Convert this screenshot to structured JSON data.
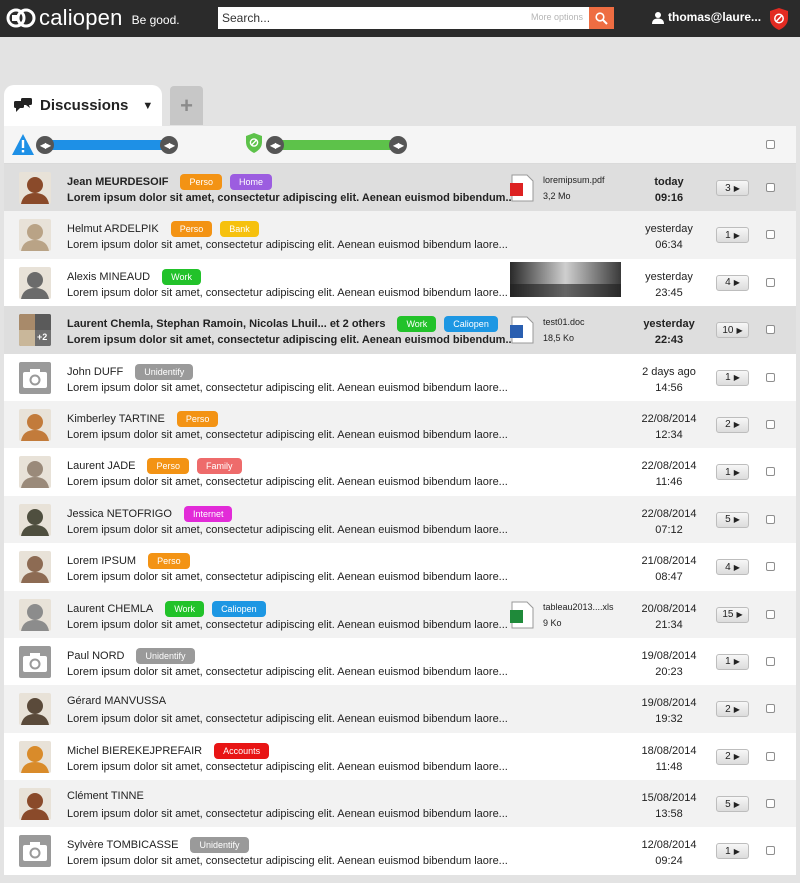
{
  "header": {
    "brand": "caliopen",
    "tagline": "Be good.",
    "search_placeholder": "Search...",
    "more_options": "More options",
    "user": "thomas@laure..."
  },
  "tabs": {
    "active_label": "Discussions",
    "add_label": "+"
  },
  "colors": {
    "topbar": "#2b2b2b",
    "accent": "#ee6d42",
    "privacy_blue": "#1e90e6",
    "importance_green": "#5dc24a",
    "tag_perso": "#f39314",
    "tag_home": "#9c5de0",
    "tag_bank": "#f6c10e",
    "tag_work": "#22c22a",
    "tag_caliopen": "#1d97e3",
    "tag_unidentify": "#9a9a9a",
    "tag_family": "#ee6b6b",
    "tag_internet": "#e22bd8",
    "tag_accounts": "#e81515"
  },
  "threads": [
    {
      "names": "Jean MEURDESOIF",
      "tags": [
        {
          "label": "Perso",
          "color": "#f39314"
        },
        {
          "label": "Home",
          "color": "#9c5de0"
        }
      ],
      "excerpt": "Lorem ipsum dolor sit amet, consectetur adipiscing elit. Aenean euismod bibendum...",
      "attachment": {
        "name": "loremipsum.pdf",
        "size": "3,2 Mo",
        "icon": "pdf-file-icon"
      },
      "date": "today",
      "time": "09:16",
      "count": "3",
      "unread": true,
      "avatar": "photo"
    },
    {
      "names": "Helmut ARDELPIK",
      "tags": [
        {
          "label": "Perso",
          "color": "#f39314"
        },
        {
          "label": "Bank",
          "color": "#f6c10e"
        }
      ],
      "excerpt": "Lorem ipsum dolor sit amet, consectetur adipiscing elit. Aenean euismod bibendum laore...",
      "date": "yesterday",
      "time": "06:34",
      "count": "1",
      "avatar": "photo"
    },
    {
      "names": "Alexis MINEAUD",
      "tags": [
        {
          "label": "Work",
          "color": "#22c22a"
        }
      ],
      "excerpt": "Lorem ipsum dolor sit amet, consectetur adipiscing elit. Aenean euismod bibendum laore...",
      "photo_preview": true,
      "date": "yesterday",
      "time": "23:45",
      "count": "4",
      "avatar": "photo"
    },
    {
      "names": "Laurent Chemla, Stephan Ramoin, Nicolas Lhuil... et 2 others",
      "tags": [
        {
          "label": "Work",
          "color": "#22c22a"
        },
        {
          "label": "Caliopen",
          "color": "#1d97e3"
        }
      ],
      "excerpt": "Lorem ipsum dolor sit amet, consectetur adipiscing elit. Aenean euismod bibendum...",
      "attachment": {
        "name": "test01.doc",
        "size": "18,5 Ko",
        "icon": "word-file-icon"
      },
      "date": "yesterday",
      "time": "22:43",
      "count": "10",
      "unread": true,
      "avatar": "group",
      "group_extra": "+2"
    },
    {
      "names": "John DUFF",
      "tags": [
        {
          "label": "Unidentify",
          "color": "#9a9a9a"
        }
      ],
      "excerpt": "Lorem ipsum dolor sit amet, consectetur adipiscing elit. Aenean euismod bibendum laore...",
      "date": "2 days ago",
      "time": "14:56",
      "count": "1",
      "avatar": "camera"
    },
    {
      "names": "Kimberley TARTINE",
      "tags": [
        {
          "label": "Perso",
          "color": "#f39314"
        }
      ],
      "excerpt": "Lorem ipsum dolor sit amet, consectetur adipiscing elit. Aenean euismod bibendum laore...",
      "date": "22/08/2014",
      "time": "12:34",
      "count": "2",
      "avatar": "photo"
    },
    {
      "names": "Laurent JADE",
      "tags": [
        {
          "label": "Perso",
          "color": "#f39314"
        },
        {
          "label": "Family",
          "color": "#ee6b6b"
        }
      ],
      "excerpt": "Lorem ipsum dolor sit amet, consectetur adipiscing elit. Aenean euismod bibendum laore...",
      "date": "22/08/2014",
      "time": "11:46",
      "count": "1",
      "avatar": "photo"
    },
    {
      "names": "Jessica NETOFRIGO",
      "tags": [
        {
          "label": "Internet",
          "color": "#e22bd8"
        }
      ],
      "excerpt": "Lorem ipsum dolor sit amet, consectetur adipiscing elit. Aenean euismod bibendum laore...",
      "date": "22/08/2014",
      "time": "07:12",
      "count": "5",
      "avatar": "photo"
    },
    {
      "names": "Lorem IPSUM",
      "tags": [
        {
          "label": "Perso",
          "color": "#f39314"
        }
      ],
      "excerpt": "Lorem ipsum dolor sit amet, consectetur adipiscing elit. Aenean euismod bibendum laore...",
      "date": "21/08/2014",
      "time": "08:47",
      "count": "4",
      "avatar": "photo"
    },
    {
      "names": "Laurent CHEMLA",
      "tags": [
        {
          "label": "Work",
          "color": "#22c22a"
        },
        {
          "label": "Caliopen",
          "color": "#1d97e3"
        }
      ],
      "excerpt": "Lorem ipsum dolor sit amet, consectetur adipiscing elit. Aenean euismod bibendum laore...",
      "attachment": {
        "name": "tableau2013....xls",
        "size": "9 Ko",
        "icon": "excel-file-icon"
      },
      "date": "20/08/2014",
      "time": "21:34",
      "count": "15",
      "avatar": "photo"
    },
    {
      "names": "Paul NORD",
      "tags": [
        {
          "label": "Unidentify",
          "color": "#9a9a9a"
        }
      ],
      "excerpt": "Lorem ipsum dolor sit amet, consectetur adipiscing elit. Aenean euismod bibendum laore...",
      "date": "19/08/2014",
      "time": "20:23",
      "count": "1",
      "avatar": "camera"
    },
    {
      "names": "Gérard MANVUSSA",
      "tags": [],
      "excerpt": "Lorem ipsum dolor sit amet, consectetur adipiscing elit. Aenean euismod bibendum laore...",
      "date": "19/08/2014",
      "time": "19:32",
      "count": "2",
      "avatar": "photo"
    },
    {
      "names": "Michel BIEREKEJPREFAIR",
      "tags": [
        {
          "label": "Accounts",
          "color": "#e81515"
        }
      ],
      "excerpt": "Lorem ipsum dolor sit amet, consectetur adipiscing elit. Aenean euismod bibendum laore...",
      "date": "18/08/2014",
      "time": "11:48",
      "count": "2",
      "avatar": "photo"
    },
    {
      "names": "Clément TINNE",
      "tags": [],
      "excerpt": "Lorem ipsum dolor sit amet, consectetur adipiscing elit. Aenean euismod bibendum laore...",
      "date": "15/08/2014",
      "time": "13:58",
      "count": "5",
      "avatar": "photo"
    },
    {
      "names": "Sylvère TOMBICASSE",
      "tags": [
        {
          "label": "Unidentify",
          "color": "#9a9a9a"
        }
      ],
      "excerpt": "Lorem ipsum dolor sit amet, consectetur adipiscing elit. Aenean euismod bibendum laore...",
      "date": "12/08/2014",
      "time": "09:24",
      "count": "1",
      "avatar": "camera"
    }
  ]
}
